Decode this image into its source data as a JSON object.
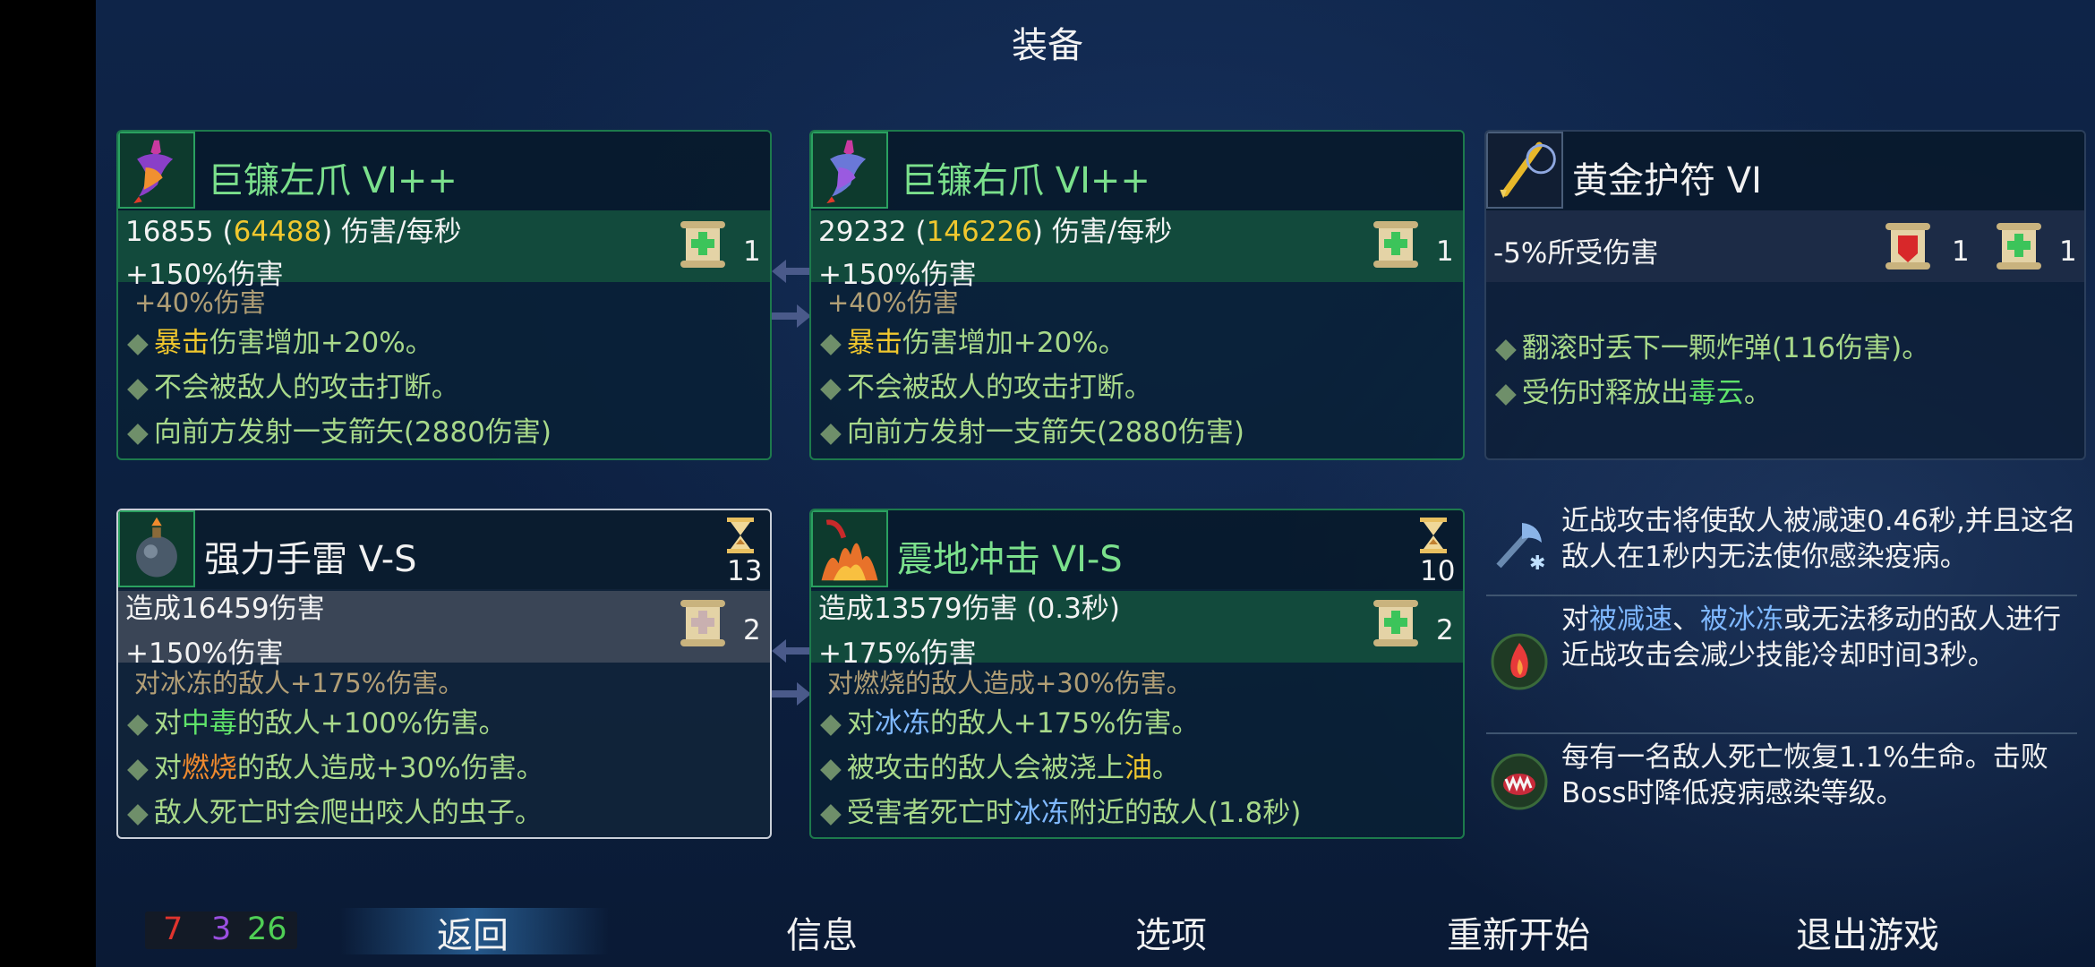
{
  "title": "装备",
  "weapons": [
    {
      "name": "巨镰左爪 VI++",
      "dps": "16855",
      "dps_crit": "64488",
      "dps_unit": "伤害/每秒",
      "bonus": "+150%伤害",
      "scroll_count": "1",
      "clipped": "+40%伤害",
      "traits": [
        {
          "hl": "暴击",
          "rest": "伤害增加+20%。"
        },
        {
          "text": "不会被敌人的攻击打断。"
        },
        {
          "text": "向前方发射一支箭矢(2880伤害)"
        }
      ]
    },
    {
      "name": "巨镰右爪 VI++",
      "dps": "29232",
      "dps_crit": "146226",
      "dps_unit": "伤害/每秒",
      "bonus": "+150%伤害",
      "scroll_count": "1",
      "clipped": "+40%伤害",
      "traits": [
        {
          "hl": "暴击",
          "rest": "伤害增加+20%。"
        },
        {
          "text": "不会被敌人的攻击打断。"
        },
        {
          "text": "向前方发射一支箭矢(2880伤害)"
        }
      ]
    }
  ],
  "amulet": {
    "name": "黄金护符 VI",
    "effect": "-5%所受伤害",
    "count_a": "1",
    "count_b": "1",
    "trait1": "翻滚时丢下一颗炸弹(116伤害)。",
    "trait2_pre": "受伤时释放出",
    "trait2_hl": "毒云",
    "trait2_post": "。"
  },
  "skills": [
    {
      "name": "强力手雷 V-S",
      "cooldown": "13",
      "damage": "造成16459伤害",
      "bonus": "+150%伤害",
      "scroll_count": "2",
      "clipped": "对冰冻的敌人+175%伤害。",
      "t1_pre": "对",
      "t1_hl": "中毒",
      "t1_post": "的敌人+100%伤害。",
      "t2_pre": "对",
      "t2_hl": "燃烧",
      "t2_post": "的敌人造成+30%伤害。",
      "t3": "敌人死亡时会爬出咬人的虫子。"
    },
    {
      "name": "震地冲击 VI-S",
      "cooldown": "10",
      "damage": "造成13579伤害 (0.3秒)",
      "bonus": "+175%伤害",
      "scroll_count": "2",
      "clipped": "对燃烧的敌人造成+30%伤害。",
      "t1_pre": "对",
      "t1_hl": "冰冻",
      "t1_post": "的敌人+175%伤害。",
      "t2_pre": "被攻击的敌人会被浇上",
      "t2_hl": "油",
      "t2_post": "。",
      "t3_pre": "受害者死亡时",
      "t3_hl": "冰冻",
      "t3_post": "附近的敌人(1.8秒)"
    }
  ],
  "mutations": [
    {
      "text": "近战攻击将使敌人被减速0.46秒,并且这名敌人在1秒内无法使你感染疫病。"
    },
    {
      "pre": "对",
      "hl1": "被减速",
      "mid": "、",
      "hl2": "被冰冻",
      "post": "或无法移动的敌人进行近战攻击会减少技能冷却时间3秒。"
    },
    {
      "text": "每有一名敌人死亡恢复1.1%生命。击败Boss时降低疫病感染等级。"
    }
  ],
  "scrolls": {
    "brutality": "7",
    "tactics": "3",
    "survival": "26"
  },
  "menu": {
    "back": "返回",
    "info": "信息",
    "options": "选项",
    "restart": "重新开始",
    "quit": "退出游戏"
  },
  "colors": {
    "brutality": "#e0342e",
    "tactics": "#9a4fe0",
    "survival": "#4fcf55",
    "green_name": "#7be08c",
    "gold": "#f0c72e"
  }
}
